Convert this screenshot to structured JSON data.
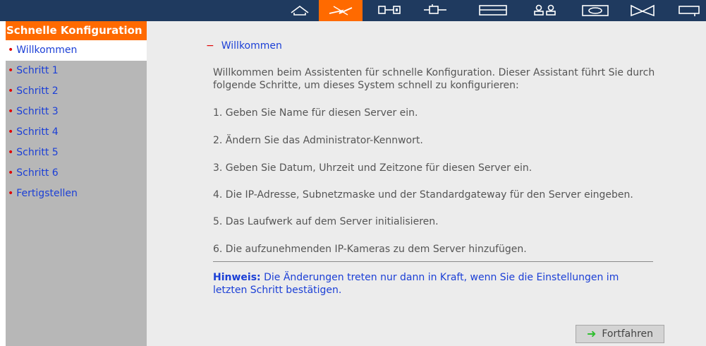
{
  "toolbar": {
    "icons": [
      "home-icon",
      "quick-config-icon",
      "system-settings-icon",
      "network-icon",
      "disk-icon",
      "users-icon",
      "camera-icon",
      "services-icon",
      "application-icon"
    ],
    "active_icon": "quick-config-icon",
    "background": "#1f3a5f",
    "accent": "#ff6a00"
  },
  "sidebar": {
    "title": "Schnelle Konfiguration",
    "items": [
      {
        "label": "Willkommen",
        "active": true
      },
      {
        "label": "Schritt 1"
      },
      {
        "label": "Schritt 2"
      },
      {
        "label": "Schritt 3"
      },
      {
        "label": "Schritt 4"
      },
      {
        "label": "Schritt 5"
      },
      {
        "label": "Schritt 6"
      },
      {
        "label": "Fertigstellen"
      }
    ],
    "bullet": "•"
  },
  "main": {
    "section_marker": "−",
    "section_title": "Willkommen",
    "intro": "Willkommen beim Assistenten für schnelle Konfiguration. Dieser Assistant führt Sie durch folgende Schritte, um dieses System schnell zu konfigurieren:",
    "steps": [
      "1. Geben Sie Name für diesen Server ein.",
      "2. Ändern Sie das Administrator-Kennwort.",
      "3. Geben Sie Datum, Uhrzeit und Zeitzone für diesen Server ein.",
      "4. Die IP-Adresse, Subnetzmaske und der Standardgateway für den Server eingeben.",
      "5. Das Laufwerk auf dem Server initialisieren.",
      "6. Die aufzunehmenden IP-Kameras zu dem Server hinzufügen."
    ],
    "note_label": "Hinweis:",
    "note_text": " Die Änderungen treten nur dann in Kraft, wenn Sie die Einstellungen im letzten Schritt bestätigen.",
    "continue_button": "Fortfahren",
    "continue_arrow": "➜"
  }
}
